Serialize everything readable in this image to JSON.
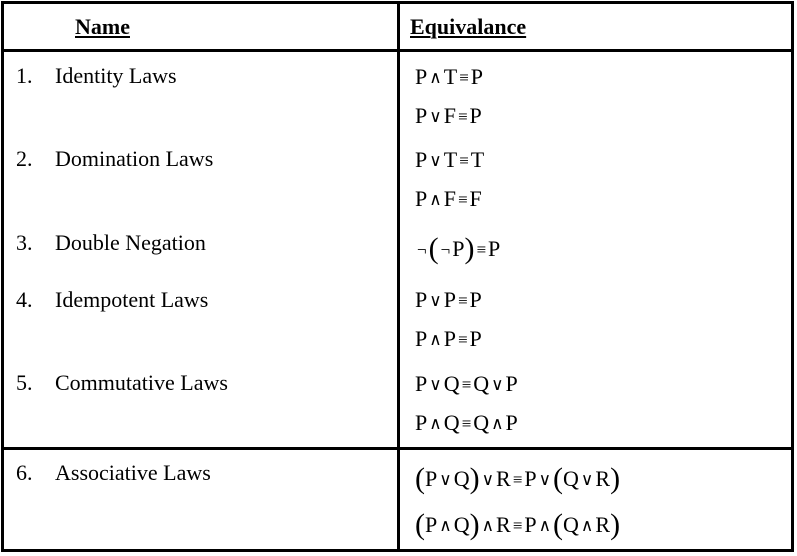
{
  "headers": {
    "name": "Name",
    "equivalence": "Equivalance"
  },
  "rows": [
    {
      "num": "1.",
      "name": "Identity Laws"
    },
    {
      "num": "2.",
      "name": "Domination Laws"
    },
    {
      "num": "3.",
      "name": "Double Negation"
    },
    {
      "num": "4.",
      "name": "Idempotent Laws"
    },
    {
      "num": "5.",
      "name": "Commutative Laws"
    },
    {
      "num": "6.",
      "name": "Associative Laws"
    }
  ],
  "formulas": {
    "identity_1": [
      "P",
      "∧",
      "T",
      "≡",
      "P"
    ],
    "identity_2": [
      "P",
      "∨",
      "F",
      "≡",
      "P"
    ],
    "domination_1": [
      "P",
      "∨",
      "T",
      "≡",
      "T"
    ],
    "domination_2": [
      "P",
      "∧",
      "F",
      "≡",
      "F"
    ],
    "double_negation": [
      "¬",
      "(",
      "¬",
      "P",
      ")",
      "≡",
      "P"
    ],
    "idempotent_1": [
      "P",
      "∨",
      "P",
      "≡",
      "P"
    ],
    "idempotent_2": [
      "P",
      "∧",
      "P",
      "≡",
      "P"
    ],
    "commutative_1": [
      "P",
      "∨",
      "Q",
      "≡",
      "Q",
      "∨",
      "P"
    ],
    "commutative_2": [
      "P",
      "∧",
      "Q",
      "≡",
      "Q",
      "∧",
      "P"
    ],
    "associative_1": [
      "(",
      "P",
      "∨",
      "Q",
      ")",
      "∨",
      "R",
      "≡",
      "P",
      "∨",
      "(",
      "Q",
      "∨",
      "R",
      ")"
    ],
    "associative_2": [
      "(",
      "P",
      "∧",
      "Q",
      ")",
      "∧",
      "R",
      "≡",
      "P",
      "∧",
      "(",
      "Q",
      "∧",
      "R",
      ")"
    ]
  }
}
